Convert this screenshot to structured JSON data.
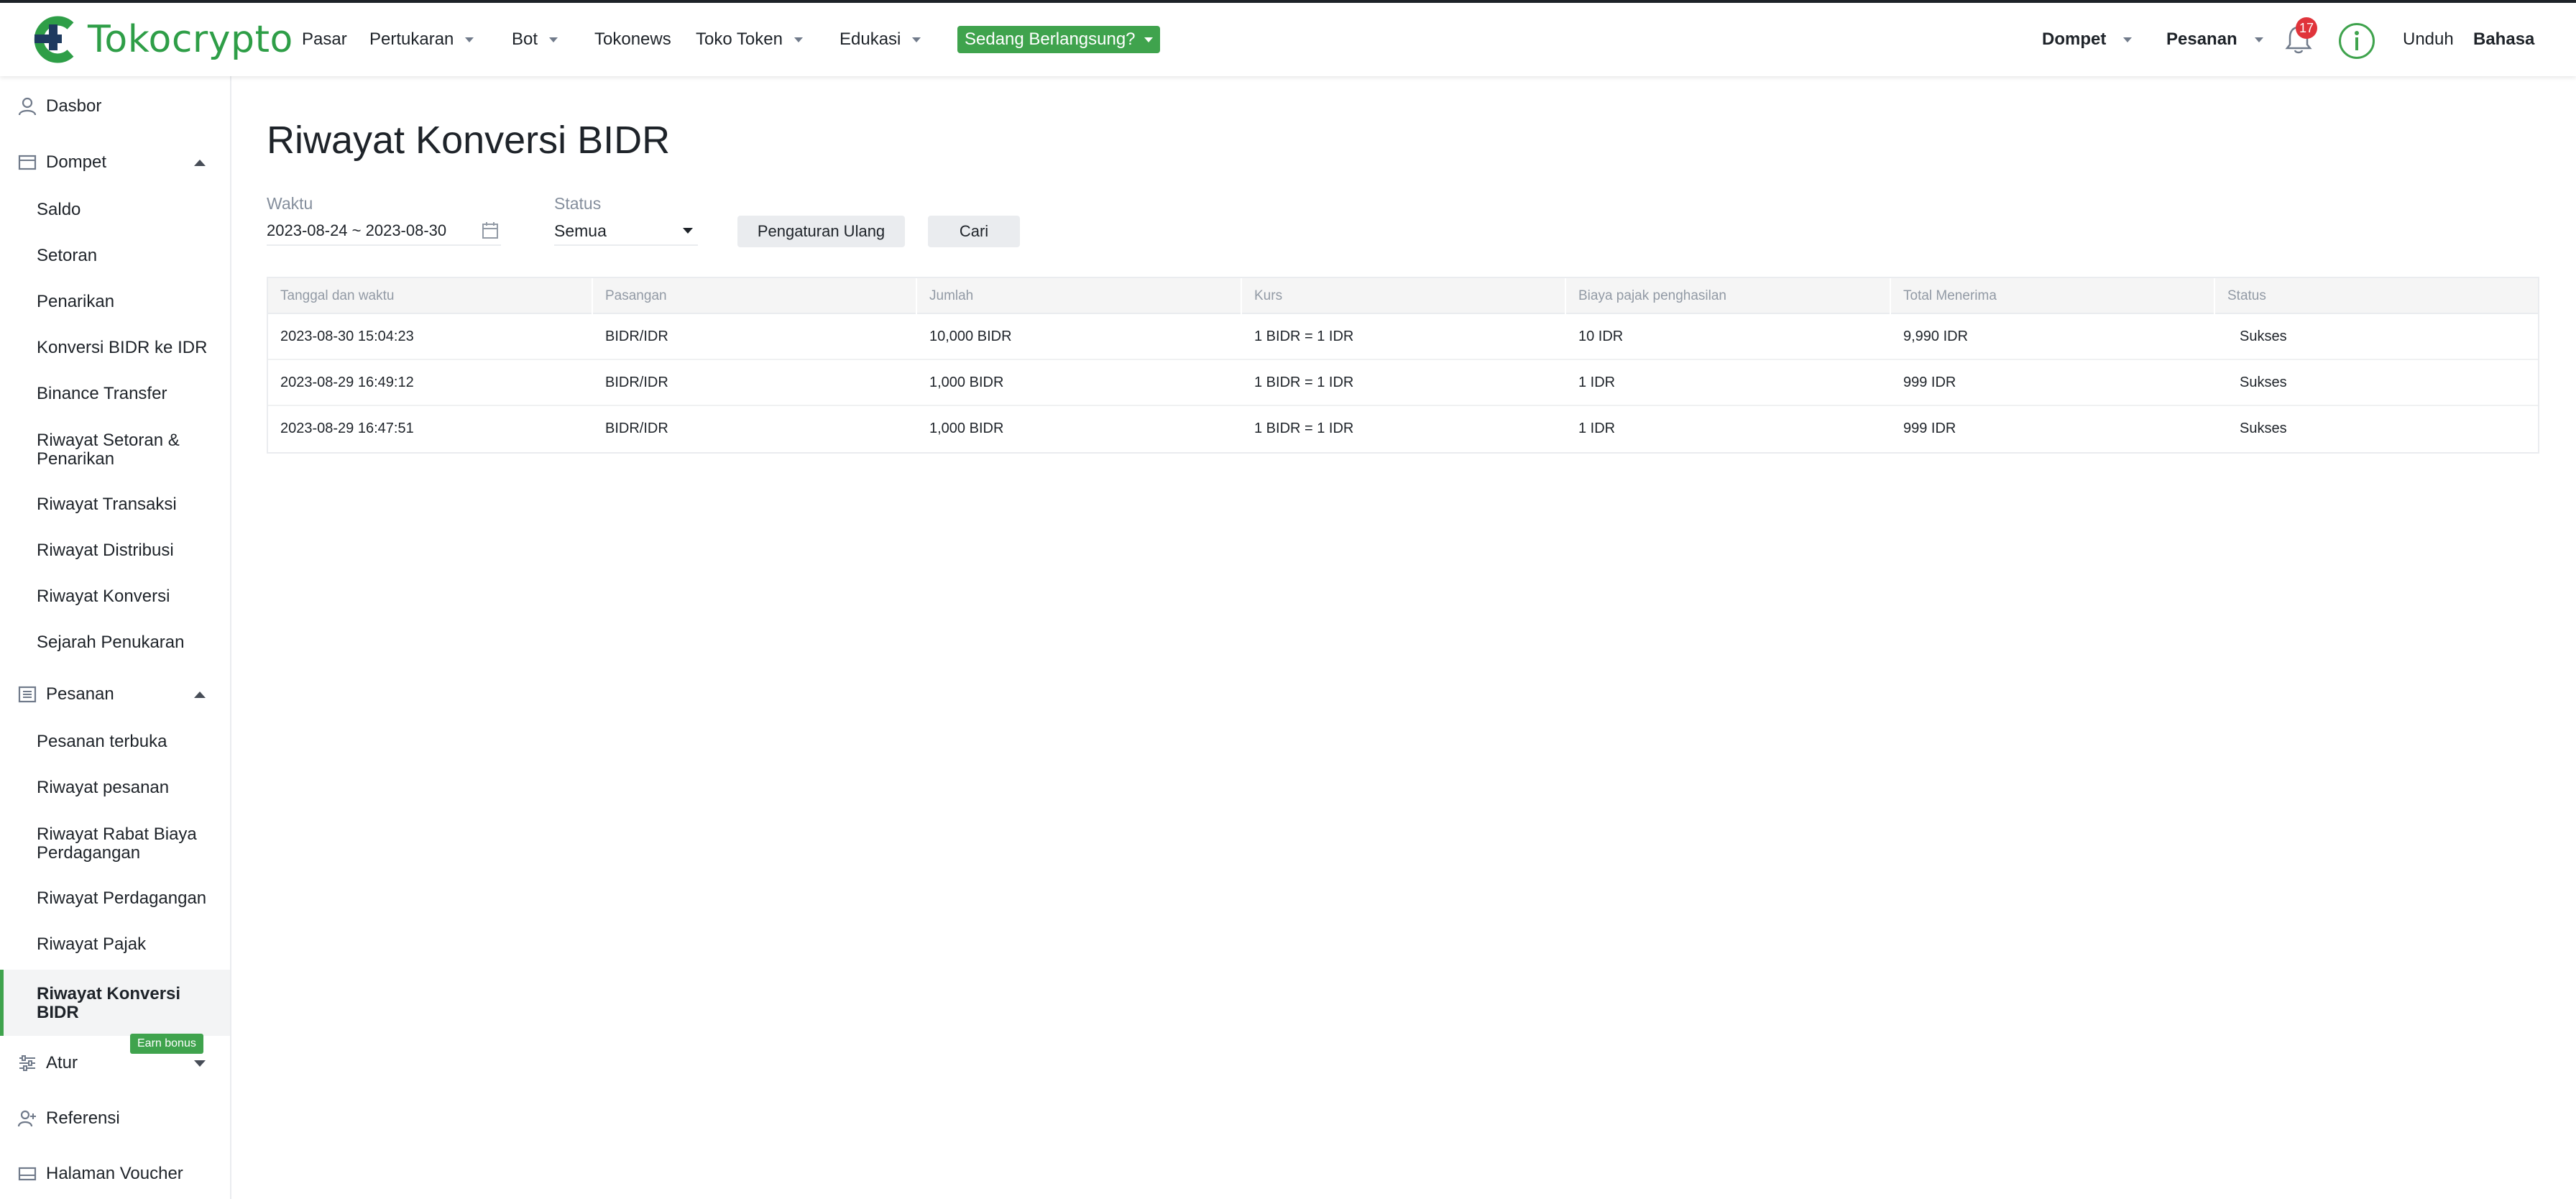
{
  "brand": {
    "name": "Tokocrypto",
    "color": "#2e9e47"
  },
  "nav": {
    "items": [
      {
        "label": "Pasar",
        "dropdown": false
      },
      {
        "label": "Pertukaran",
        "dropdown": true
      },
      {
        "label": "Bot",
        "dropdown": true
      },
      {
        "label": "Tokonews",
        "dropdown": false
      },
      {
        "label": "Toko Token",
        "dropdown": true
      },
      {
        "label": "Edukasi",
        "dropdown": true
      }
    ],
    "live_badge": "Sedang Berlangsung?",
    "right": {
      "wallet": "Dompet",
      "orders": "Pesanan",
      "notification_count": "17",
      "download": "Unduh",
      "language": "Bahasa"
    }
  },
  "sidebar": {
    "dashboard": "Dasbor",
    "wallet": {
      "label": "Dompet",
      "items": [
        "Saldo",
        "Setoran",
        "Penarikan",
        "Konversi BIDR ke IDR",
        "Binance Transfer",
        "Riwayat Setoran & Penarikan",
        "Riwayat Transaksi",
        "Riwayat Distribusi",
        "Riwayat Konversi",
        "Sejarah Penukaran"
      ]
    },
    "orders": {
      "label": "Pesanan",
      "items": [
        "Pesanan terbuka",
        "Riwayat pesanan",
        "Riwayat Rabat Biaya Perdagangan",
        "Riwayat Perdagangan",
        "Riwayat Pajak",
        "Riwayat Konversi BIDR"
      ]
    },
    "settings": "Atur",
    "referral": "Referensi",
    "earn_bonus": "Earn bonus",
    "voucher": "Halaman Voucher",
    "accent": "#3fa34d"
  },
  "main": {
    "title": "Riwayat Konversi BIDR",
    "filters": {
      "time_label": "Waktu",
      "time_value": "2023-08-24 ~ 2023-08-30",
      "status_label": "Status",
      "status_value": "Semua",
      "reset_button": "Pengaturan Ulang",
      "search_button": "Cari"
    },
    "table": {
      "columns": [
        "Tanggal dan waktu",
        "Pasangan",
        "Jumlah",
        "Kurs",
        "Biaya pajak penghasilan",
        "Total Menerima",
        "Status"
      ],
      "rows": [
        [
          "2023-08-30 15:04:23",
          "BIDR/IDR",
          "10,000 BIDR",
          "1 BIDR = 1 IDR",
          "10 IDR",
          "9,990 IDR",
          "Sukses"
        ],
        [
          "2023-08-29 16:49:12",
          "BIDR/IDR",
          "1,000 BIDR",
          "1 BIDR = 1 IDR",
          "1 IDR",
          "999 IDR",
          "Sukses"
        ],
        [
          "2023-08-29 16:47:51",
          "BIDR/IDR",
          "1,000 BIDR",
          "1 BIDR = 1 IDR",
          "1 IDR",
          "999 IDR",
          "Sukses"
        ]
      ]
    }
  }
}
